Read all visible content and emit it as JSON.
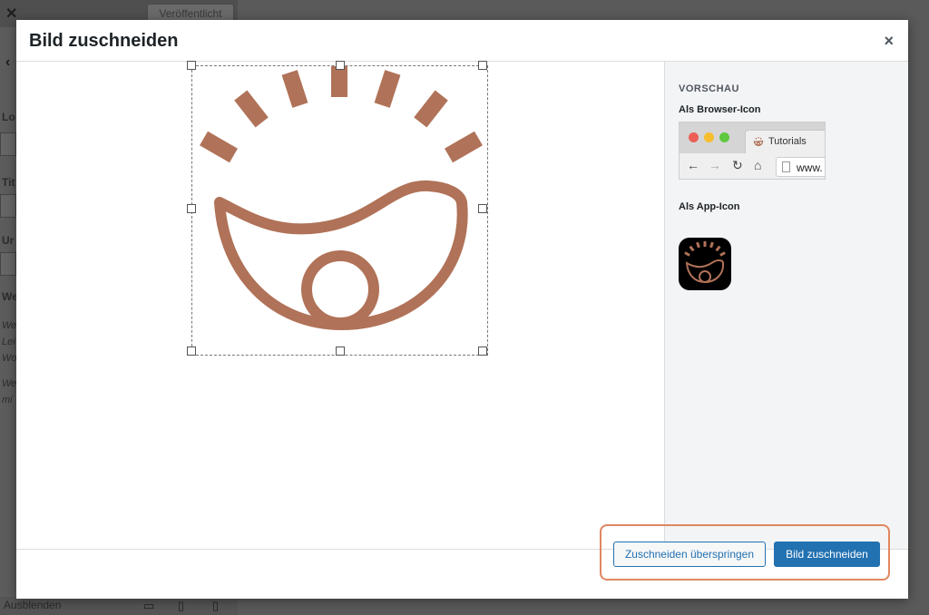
{
  "background": {
    "publish_label": "Veröffentlicht",
    "close_glyph": "✕",
    "back_glyph": "‹",
    "preview_title_fragment": "Tutorials",
    "sidebar_labels": [
      "Lo",
      "Tit",
      "Ur",
      "We"
    ],
    "sidebar_italic_lines": [
      "We",
      "Lei",
      "Wo",
      "We",
      "mi"
    ],
    "hide_label": "Ausblenden",
    "device_icons": [
      "desktop-icon",
      "tablet-icon",
      "mobile-icon"
    ]
  },
  "modal": {
    "title": "Bild zuschneiden",
    "close_glyph": "×"
  },
  "crop": {
    "image_icon": "eye-sunrise-logo",
    "icon_color": "#b07258"
  },
  "sidebar": {
    "preview_heading": "VORSCHAU",
    "browser_icon_heading": "Als Browser-Icon",
    "tab_label": "Tutorials",
    "url_text": "www.",
    "app_icon_heading": "Als App-Icon",
    "browser_dot_colors": [
      "#ec5f56",
      "#f6be2f",
      "#5ec83f"
    ]
  },
  "footer": {
    "skip_label": "Zuschneiden überspringen",
    "crop_label": "Bild zuschneiden",
    "highlight_color": "#e0875f",
    "primary_color": "#2271b1"
  }
}
